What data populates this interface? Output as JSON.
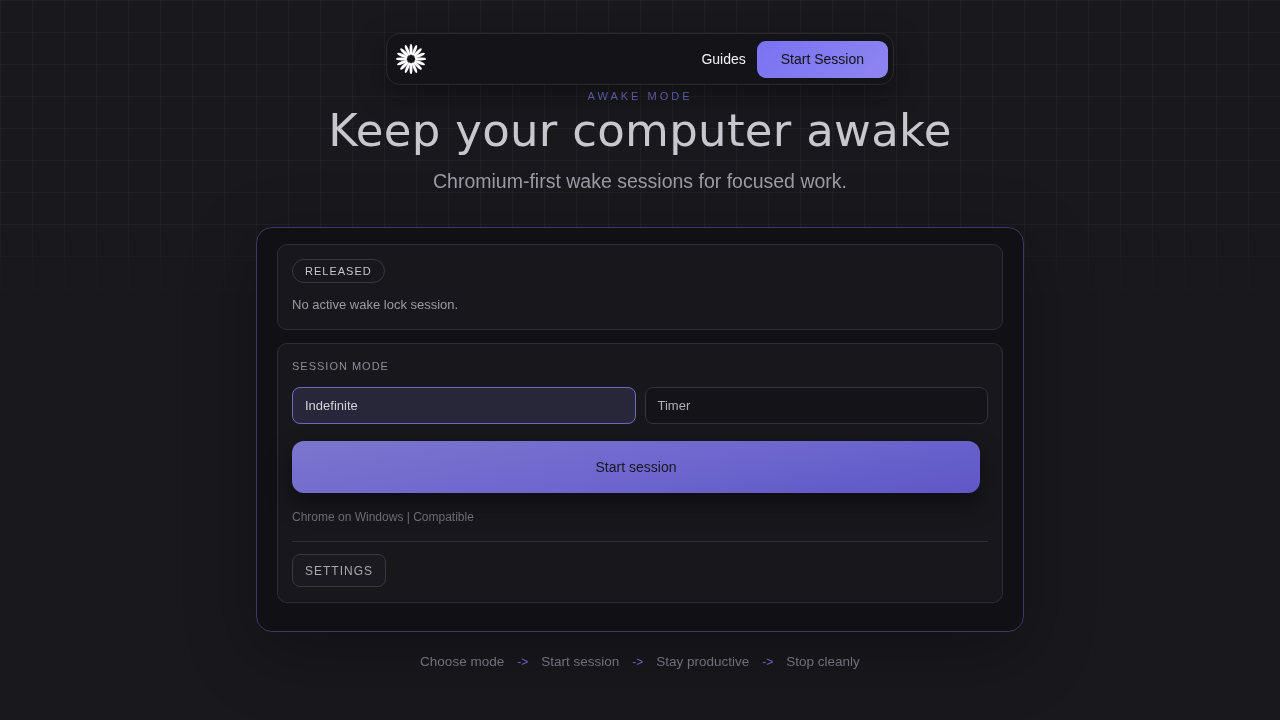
{
  "nav": {
    "links": [
      {
        "label": "Guides"
      }
    ],
    "cta": "Start Session"
  },
  "hero": {
    "eyebrow": "AWAKE MODE",
    "title": "Keep your computer awake",
    "subtitle": "Chromium-first wake sessions for focused work."
  },
  "status": {
    "badge": "RELEASED",
    "message": "No active wake lock session."
  },
  "session": {
    "label": "SESSION MODE",
    "modes": [
      {
        "label": "Indefinite",
        "selected": true
      },
      {
        "label": "Timer",
        "selected": false
      }
    ],
    "start_button": "Start session",
    "compatibility": "Chrome on Windows | Compatible",
    "settings_button": "SETTINGS"
  },
  "steps": [
    {
      "label": "Choose mode",
      "arrow": "->"
    },
    {
      "label": "Start session",
      "arrow": "->"
    },
    {
      "label": "Stay productive",
      "arrow": "->"
    },
    {
      "label": "Stop cleanly"
    }
  ]
}
